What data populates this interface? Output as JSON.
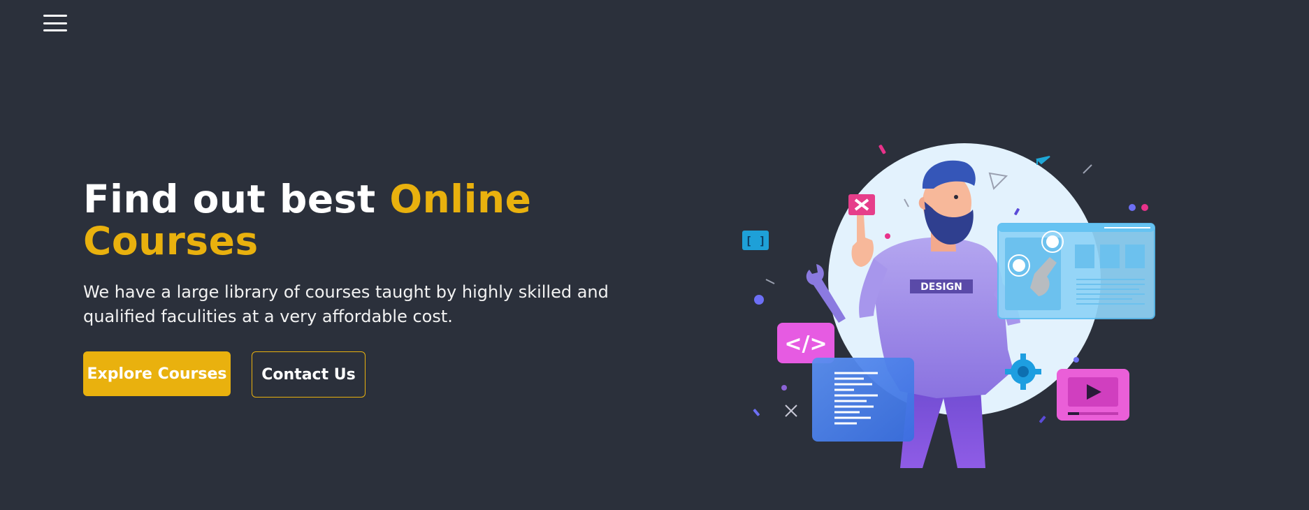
{
  "nav": {
    "menu_icon": "hamburger-menu-icon"
  },
  "hero": {
    "title_white": "Find out best ",
    "title_highlight_1": "Online",
    "title_highlight_2": "Courses",
    "description": "We have a large library of courses taught by highly skilled and qualified faculities at a very affordable cost.",
    "primary_button": "Explore Courses",
    "secondary_button": "Contact Us"
  },
  "illustration": {
    "shirt_text": "DESIGN",
    "code_tag": "</>",
    "brackets": "[ ]"
  },
  "colors": {
    "background": "#2b303b",
    "accent": "#e9b10e",
    "text": "#ffffff"
  }
}
